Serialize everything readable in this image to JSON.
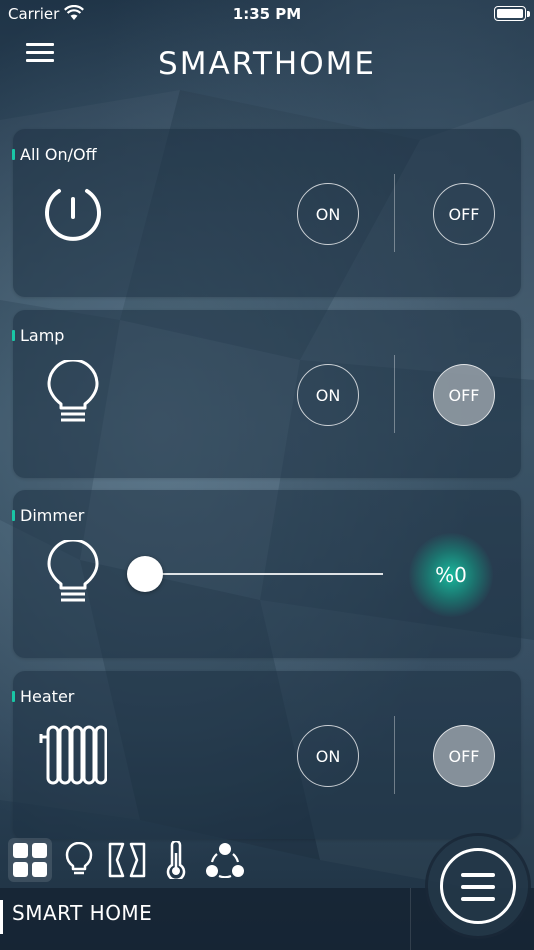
{
  "status_bar": {
    "carrier": "Carrier",
    "time": "1:35 PM"
  },
  "header": {
    "logo_text": "SMARTHOME",
    "menu_icon": "hamburger-menu-icon"
  },
  "cards": [
    {
      "title": "All On/Off",
      "icon": "power-icon",
      "on_label": "ON",
      "off_label": "OFF",
      "state": "none"
    },
    {
      "title": "Lamp",
      "icon": "bulb-icon",
      "on_label": "ON",
      "off_label": "OFF",
      "state": "off"
    },
    {
      "title": "Dimmer",
      "icon": "bulb-icon",
      "value_label": "%0",
      "level": 0
    },
    {
      "title": "Heater",
      "icon": "radiator-icon",
      "on_label": "ON",
      "off_label": "OFF",
      "state": "off"
    }
  ],
  "tab_bar": {
    "items": [
      {
        "icon": "dashboard-grid-icon",
        "active": true
      },
      {
        "icon": "lightbulb-icon",
        "active": false
      },
      {
        "icon": "curtain-icon",
        "active": false
      },
      {
        "icon": "thermometer-icon",
        "active": false
      },
      {
        "icon": "scenes-icon",
        "active": false
      }
    ]
  },
  "footer": {
    "title": "SMART HOME"
  },
  "colors": {
    "accent": "#19c6a6",
    "active_button": "#969fa7",
    "card_bg": "#1e3244"
  }
}
